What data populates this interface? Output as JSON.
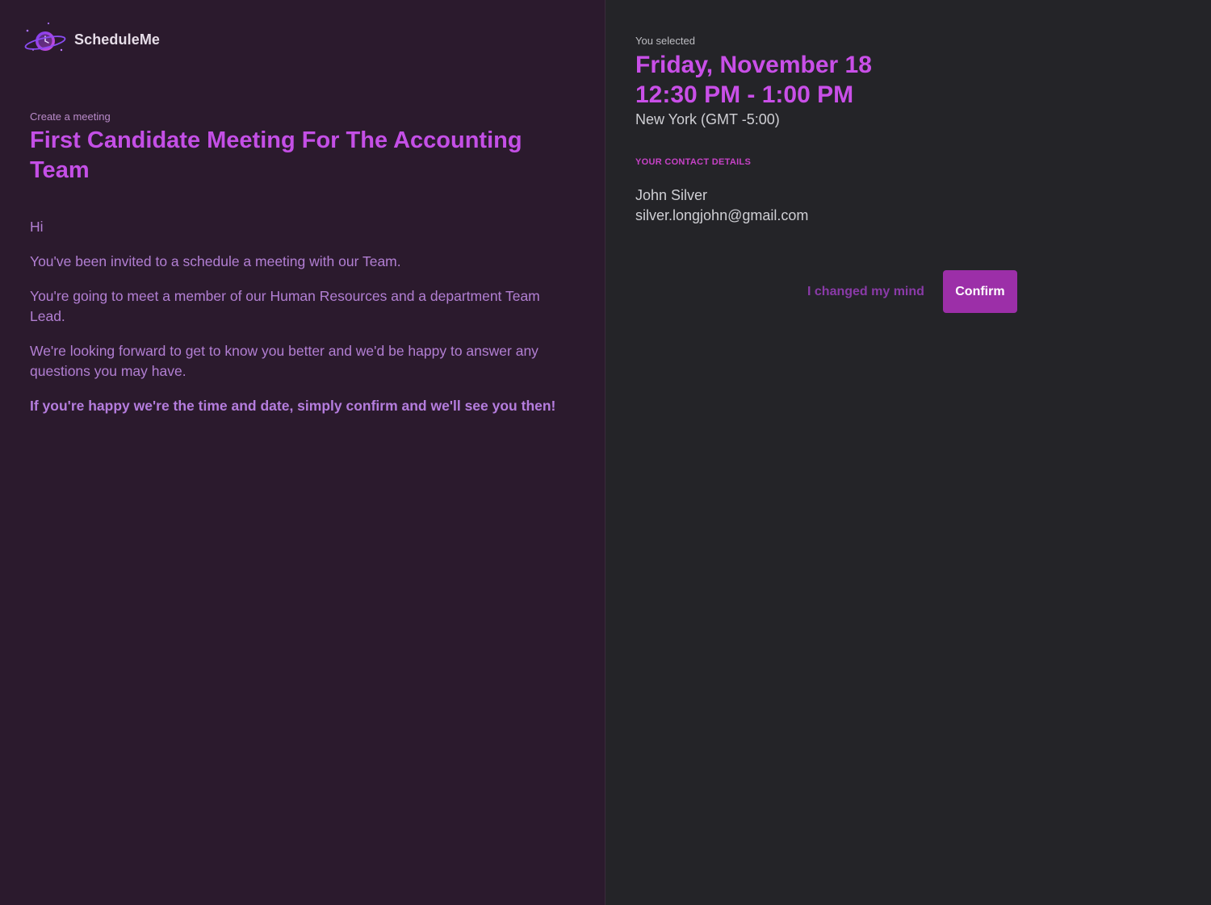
{
  "app": {
    "name": "ScheduleMe",
    "logo_icon": "planet-clock-icon"
  },
  "meeting": {
    "eyebrow": "Create a meeting",
    "title": "First Candidate Meeting For The Accounting Team",
    "paragraphs": [
      "Hi",
      "You've been invited to a schedule a meeting with our Team.",
      "You're going to meet a member of our Human Resources and a department Team Lead.",
      "We're looking forward to get to know you better and we'd be happy to answer any questions you may have."
    ],
    "closing": "If you're happy we're the time and date, simply confirm and we'll see you then!"
  },
  "selection": {
    "label": "You selected",
    "date": "Friday, November 18",
    "time": "12:30 PM - 1:00 PM",
    "timezone": "New York (GMT -5:00)"
  },
  "contact": {
    "heading": "YOUR CONTACT DETAILS",
    "name": "John Silver",
    "email": "silver.longjohn@gmail.com"
  },
  "actions": {
    "cancel_label": "I changed my mind",
    "confirm_label": "Confirm"
  },
  "colors": {
    "accent": "#c94fe8",
    "button": "#9c2fa8",
    "left_bg": "#2b1a2d",
    "right_bg": "#242428"
  }
}
